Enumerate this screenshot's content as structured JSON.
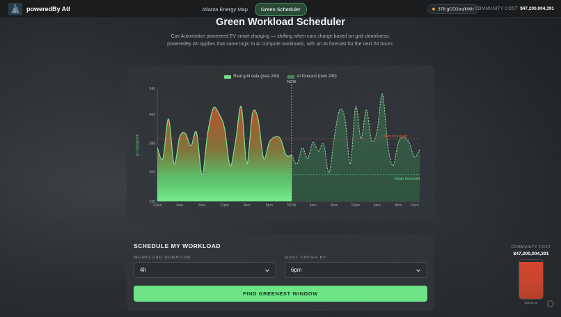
{
  "header": {
    "brand": "poweredBy AtI",
    "nav": [
      {
        "label": "Atlanta Energy Map",
        "active": false
      },
      {
        "label": "Green Scheduler",
        "active": true
      }
    ],
    "carbon_chip": "378 gCO2eq/kWh",
    "community_cost_label": "COMMUNITY COST",
    "community_cost_value": "$47,200,004,391"
  },
  "page": {
    "title": "Green Workload Scheduler",
    "subtitle": "Cox Automotive pioneered EV smart charging — shifting when cars charge based on grid cleanliness. poweredBy AtI applies that same logic to AI compute workloads, with an AI forecast for the next 24 hours."
  },
  "chart_data": {
    "type": "area",
    "legend": [
      "Real grid data (past 24h)",
      "AI forecast (next 24h)"
    ],
    "ylabel": "gCO2eq/kWh",
    "ylim": [
      226,
      540
    ],
    "yticks": [
      226,
      308,
      388,
      468,
      540
    ],
    "x_ticks_past": [
      "12am",
      "4am",
      "8am",
      "12pm",
      "4pm",
      "8pm"
    ],
    "x_ticks_future": [
      "NOW",
      "4am",
      "8am",
      "12pm",
      "4pm",
      "8pm",
      "11pm"
    ],
    "now_label": "NOW",
    "dirty_threshold": {
      "label": "Dirty threshold",
      "value": 400
    },
    "clean_threshold": {
      "label": "Clean threshold",
      "value": 300
    },
    "series": [
      {
        "name": "Real grid data (past 24h)",
        "x": [
          0,
          1,
          2,
          3,
          4,
          5,
          6,
          7,
          8,
          9,
          10,
          11,
          12,
          13,
          14,
          15,
          16,
          17,
          18,
          19,
          20,
          21,
          22,
          23,
          24
        ],
        "values": [
          375,
          345,
          455,
          330,
          405,
          415,
          380,
          418,
          300,
          415,
          485,
          470,
          430,
          325,
          395,
          490,
          330,
          470,
          455,
          345,
          390,
          405,
          400,
          355,
          355
        ]
      },
      {
        "name": "AI forecast (next 24h)",
        "x": [
          24,
          25,
          26,
          27,
          28,
          29,
          30,
          31,
          32,
          33,
          34,
          35,
          36,
          37,
          38,
          39,
          40,
          41,
          42,
          43,
          44,
          45,
          46,
          47,
          48
        ],
        "values": [
          355,
          330,
          375,
          345,
          390,
          365,
          385,
          305,
          405,
          480,
          455,
          330,
          490,
          400,
          480,
          395,
          420,
          525,
          385,
          325,
          390,
          405,
          390,
          350,
          370
        ]
      }
    ]
  },
  "colors": {
    "past_line": "#7bdc8c",
    "forecast_line": "#8fd19b",
    "dirty": "#d9533f",
    "clean": "#6fdc86",
    "accent": "#6ee487"
  },
  "scheduler": {
    "title": "SCHEDULE MY WORKLOAD",
    "duration_label": "WORKLOAD DURATION",
    "duration_value": "4h",
    "finish_label": "MUST FINISH BY",
    "finish_value": "6pm",
    "cta": "FIND GREENEST WINDOW"
  },
  "widget": {
    "label": "COMMUNITY COST",
    "value": "$47,200,004,391",
    "fill_fraction": 0.95,
    "caption": "$4003.46"
  }
}
